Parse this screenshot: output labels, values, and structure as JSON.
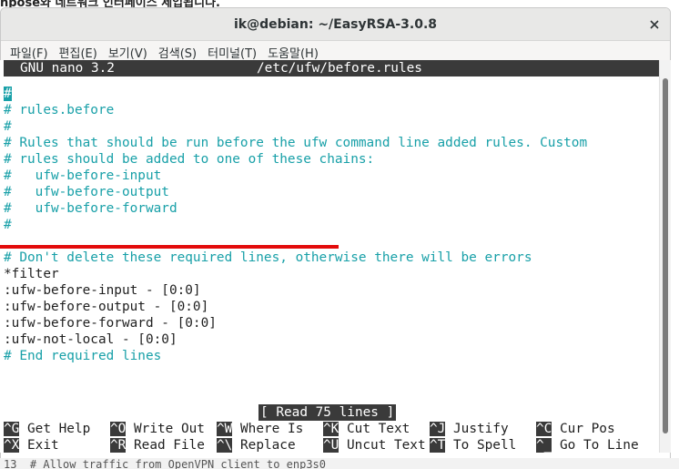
{
  "background": {
    "top_text": "npose와 네트워크 인터페이스 세입됩니다.",
    "bottom_text": "13  # Allow traffic from OpenVPN client to enp3s0"
  },
  "window": {
    "title": "ik@debian: ~/EasyRSA-3.0.8",
    "menu": [
      "파일(F)",
      "편집(E)",
      "보기(V)",
      "검색(S)",
      "터미널(T)",
      "도움말(H)"
    ]
  },
  "nano": {
    "version": "GNU nano 3.2",
    "filename": "/etc/ufw/before.rules",
    "cursor_char": "#",
    "lines": [
      {
        "text": "",
        "type": "cursor"
      },
      {
        "text": "# rules.before",
        "type": "comment"
      },
      {
        "text": "#",
        "type": "comment"
      },
      {
        "text": "# Rules that should be run before the ufw command line added rules. Custom",
        "type": "comment"
      },
      {
        "text": "# rules should be added to one of these chains:",
        "type": "comment"
      },
      {
        "text": "#   ufw-before-input",
        "type": "comment"
      },
      {
        "text": "#   ufw-before-output",
        "type": "comment"
      },
      {
        "text": "#   ufw-before-forward",
        "type": "comment"
      },
      {
        "text": "#",
        "type": "comment"
      },
      {
        "text": "",
        "type": "plain"
      },
      {
        "text": "# Don't delete these required lines, otherwise there will be errors",
        "type": "comment"
      },
      {
        "text": "*filter",
        "type": "plain"
      },
      {
        "text": ":ufw-before-input - [0:0]",
        "type": "plain"
      },
      {
        "text": ":ufw-before-output - [0:0]",
        "type": "plain"
      },
      {
        "text": ":ufw-before-forward - [0:0]",
        "type": "plain"
      },
      {
        "text": ":ufw-not-local - [0:0]",
        "type": "plain"
      },
      {
        "text": "# End required lines",
        "type": "comment"
      }
    ],
    "status": "[ Read 75 lines ]",
    "shortcuts_row1": [
      {
        "key": "^G",
        "label": "Get Help"
      },
      {
        "key": "^O",
        "label": "Write Out"
      },
      {
        "key": "^W",
        "label": "Where Is"
      },
      {
        "key": "^K",
        "label": "Cut Text"
      },
      {
        "key": "^J",
        "label": "Justify"
      },
      {
        "key": "^C",
        "label": "Cur Pos"
      }
    ],
    "shortcuts_row2": [
      {
        "key": "^X",
        "label": "Exit"
      },
      {
        "key": "^R",
        "label": "Read File"
      },
      {
        "key": "^\\",
        "label": "Replace"
      },
      {
        "key": "^U",
        "label": "Uncut Text"
      },
      {
        "key": "^T",
        "label": "To Spell"
      },
      {
        "key": "^_",
        "label": "Go To Line"
      }
    ]
  },
  "colors": {
    "comment": "#18a0a8",
    "highlight": "#e30b0b",
    "inverse_bg": "#3a3a3a"
  }
}
